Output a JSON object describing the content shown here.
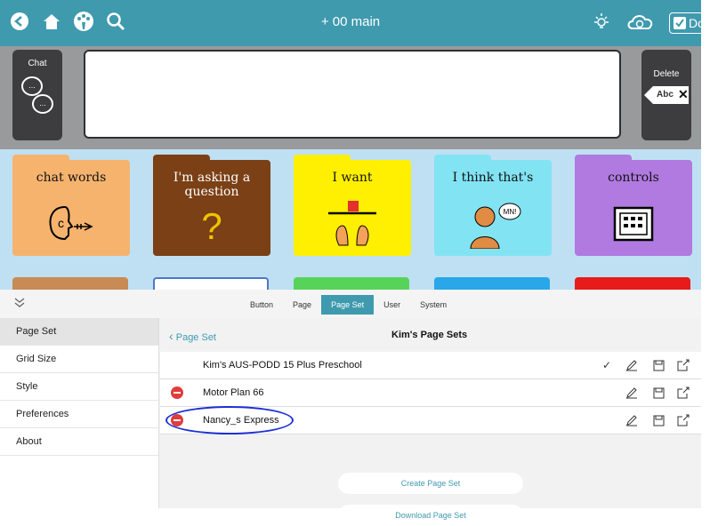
{
  "topbar": {
    "title": "+ 00 main",
    "done_label": "Done",
    "icons": [
      "back-icon",
      "home-icon",
      "palette-icon",
      "search-icon",
      "brightness-icon",
      "cloud-sync-icon",
      "check-icon"
    ]
  },
  "message_row": {
    "chat_label": "Chat",
    "delete_label": "Delete",
    "delete_key_text": "Abc",
    "message_text": ""
  },
  "folders": [
    {
      "label": "chat words",
      "color": "#f6b36e"
    },
    {
      "label": "I'm asking a question",
      "color": "#7b4016"
    },
    {
      "label": "I want",
      "color": "#ffef00"
    },
    {
      "label": "I think that's",
      "color": "#82e3f3"
    },
    {
      "label": "controls",
      "color": "#b07ae0"
    }
  ],
  "panel": {
    "segments": [
      "Button",
      "Page",
      "Page Set",
      "User",
      "System"
    ],
    "active_segment": "Page Set",
    "sidebar": [
      "Page Set",
      "Grid Size",
      "Style",
      "Preferences",
      "About"
    ],
    "back_label": "Page Set",
    "content_title": "Kim's Page Sets",
    "page_sets": [
      {
        "name": "Kim's AUS-PODD 15 Plus Preschool",
        "selected": true,
        "removable": false
      },
      {
        "name": "Motor Plan 66",
        "selected": false,
        "removable": true
      },
      {
        "name": "Nancy_s Express",
        "selected": false,
        "removable": true,
        "highlighted": true
      }
    ],
    "create_label": "Create Page Set",
    "download_label": "Download Page Set"
  }
}
